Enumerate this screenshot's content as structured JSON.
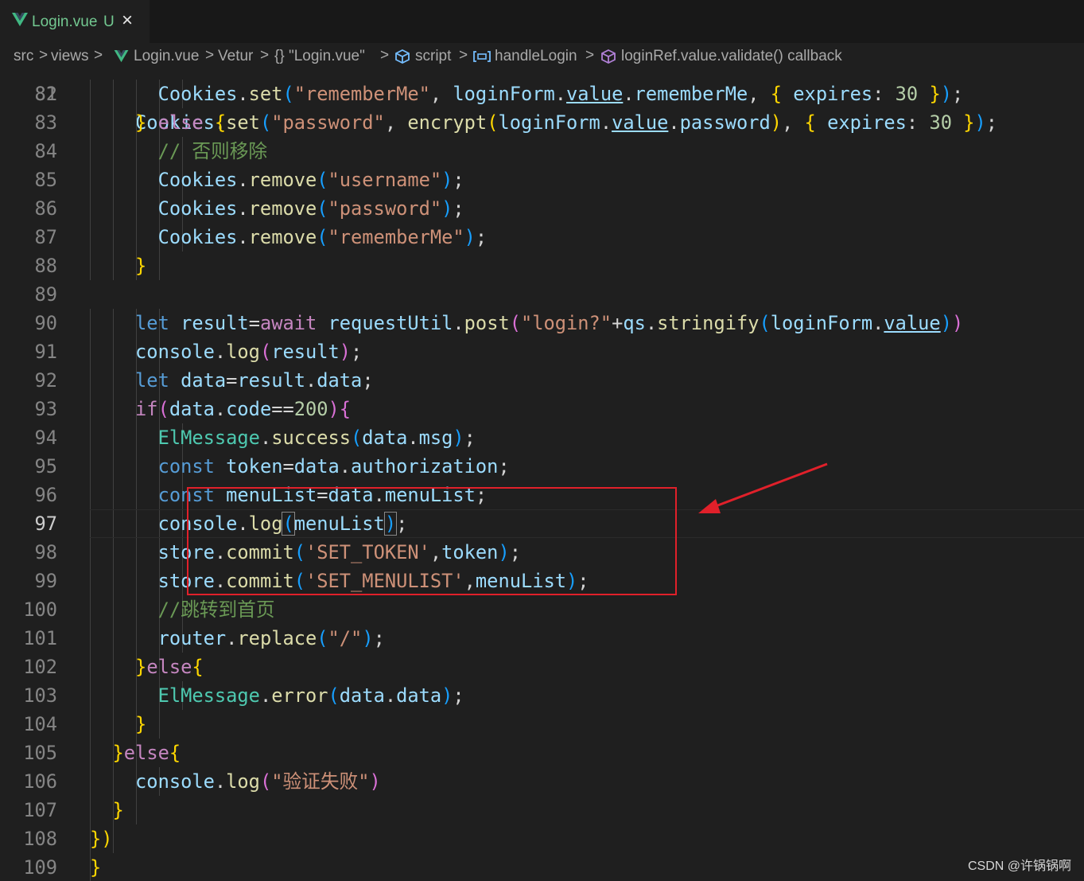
{
  "tab": {
    "file_name": "Login.vue",
    "status_badge": "U",
    "close_icon": "×"
  },
  "breadcrumb": {
    "items": [
      "src",
      "views",
      "Login.vue",
      "Vetur",
      "{} \"Login.vue\"",
      "script",
      "handleLogin",
      "loginRef.value.validate() callback"
    ],
    "separator": ">"
  },
  "editor": {
    "active_line": "97",
    "top_partial_line": "    Cookies.set(\"password\", encrypt(loginForm.value.password), { expires: 30 });",
    "lines": [
      {
        "n": "82",
        "text": "          Cookies.set(\"rememberMe\", loginForm.value.rememberMe, { expires: 30 });"
      },
      {
        "n": "83",
        "text": "        } else {"
      },
      {
        "n": "84",
        "text": "          // 否则移除"
      },
      {
        "n": "85",
        "text": "          Cookies.remove(\"username\");"
      },
      {
        "n": "86",
        "text": "          Cookies.remove(\"password\");"
      },
      {
        "n": "87",
        "text": "          Cookies.remove(\"rememberMe\");"
      },
      {
        "n": "88",
        "text": "        }"
      },
      {
        "n": "89",
        "text": ""
      },
      {
        "n": "90",
        "text": "        let result=await requestUtil.post(\"login?\"+qs.stringify(loginForm.value))"
      },
      {
        "n": "91",
        "text": "        console.log(result);"
      },
      {
        "n": "92",
        "text": "        let data=result.data;"
      },
      {
        "n": "93",
        "text": "        if(data.code==200){"
      },
      {
        "n": "94",
        "text": "          ElMessage.success(data.msg);"
      },
      {
        "n": "95",
        "text": "          const token=data.authorization;"
      },
      {
        "n": "96",
        "text": "          const menuList=data.menuList;"
      },
      {
        "n": "97",
        "text": "          console.log(menuList);"
      },
      {
        "n": "98",
        "text": "          store.commit('SET_TOKEN',token);"
      },
      {
        "n": "99",
        "text": "          store.commit('SET_MENULIST',menuList);"
      },
      {
        "n": "100",
        "text": "          //跳转到首页"
      },
      {
        "n": "101",
        "text": "          router.replace(\"/\");"
      },
      {
        "n": "102",
        "text": "        }else{"
      },
      {
        "n": "103",
        "text": "          ElMessage.error(data.data);"
      },
      {
        "n": "104",
        "text": "        }"
      },
      {
        "n": "105",
        "text": "      }else{"
      },
      {
        "n": "106",
        "text": "        console.log(\"验证失败\")"
      },
      {
        "n": "107",
        "text": "      }"
      },
      {
        "n": "108",
        "text": "    })"
      },
      {
        "n": "109",
        "text": "  }"
      }
    ]
  },
  "annotation": {
    "box_color": "#e0202a",
    "arrow_color": "#e0202a"
  },
  "watermark": "CSDN @许锅锅啊",
  "colors": {
    "background": "#1f1f1f",
    "tab_text_untracked": "#73c991",
    "keyword": "#569cd6",
    "variable": "#9cdcfe",
    "function": "#dcdcaa",
    "string": "#ce9178",
    "comment": "#6a9955"
  }
}
